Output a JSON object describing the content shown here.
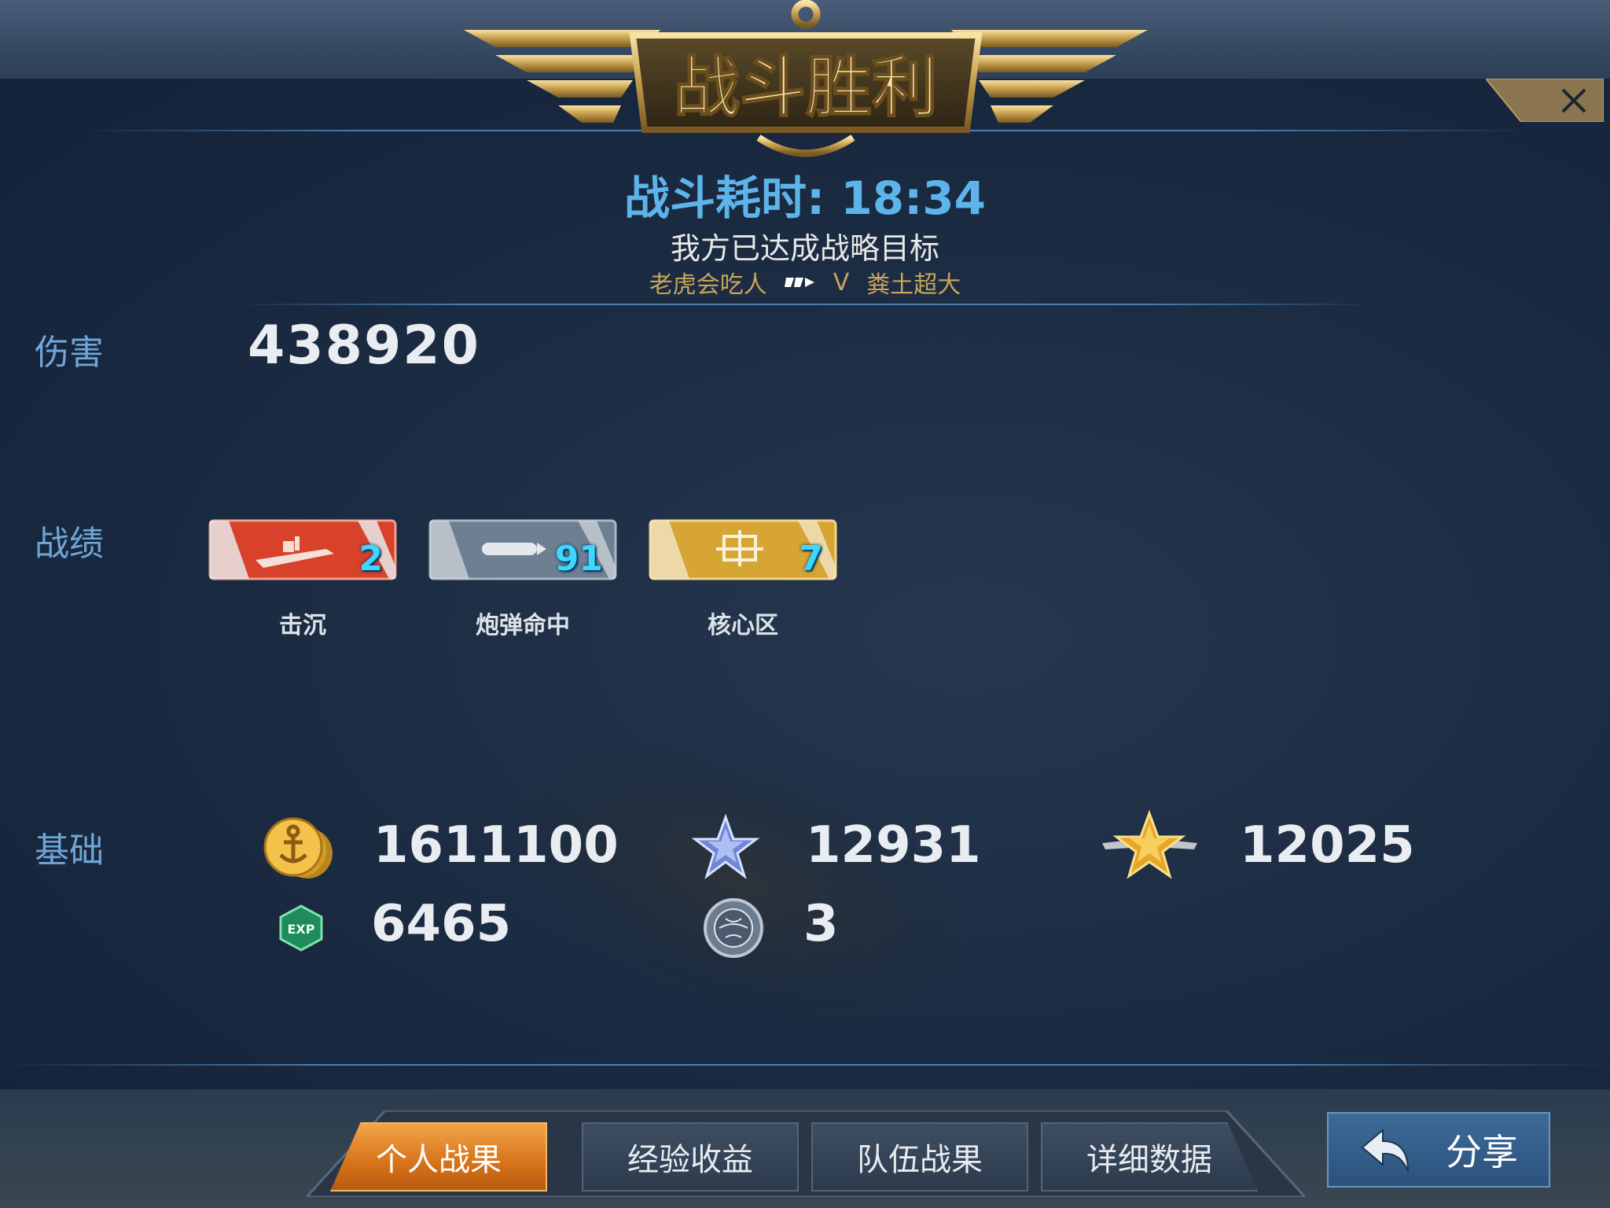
{
  "header": {
    "banner_title": "战斗胜利",
    "time_label": "战斗耗时: 18:34",
    "objective": "我方已达成战略目标",
    "player_left": "老虎会吃人",
    "vs": "V",
    "player_right": "粪土超大"
  },
  "rows": {
    "damage_label": "伤害",
    "damage_value": "438920",
    "record_label": "战绩",
    "base_label": "基础"
  },
  "medals": [
    {
      "caption": "击沉",
      "count": "2",
      "color": "#d8412a"
    },
    {
      "caption": "炮弹命中",
      "count": "91",
      "color": "#6e7f92"
    },
    {
      "caption": "核心区",
      "count": "7",
      "color": "#d7a534"
    }
  ],
  "base_stats": {
    "silver": "1611100",
    "exp": "6465",
    "blue_star": "12931",
    "globe": "3",
    "gold_star": "12025",
    "exp_icon_text": "EXP"
  },
  "tabs": [
    {
      "label": "个人战果",
      "active": true
    },
    {
      "label": "经验收益",
      "active": false
    },
    {
      "label": "队伍战果",
      "active": false
    },
    {
      "label": "详细数据",
      "active": false
    }
  ],
  "share_label": "分享",
  "icons": {
    "close": "close-icon",
    "share": "back-arrow-icon",
    "anchor": "anchor-icon"
  },
  "colors": {
    "accent_blue": "#5db4ea",
    "label_blue": "#6fa6d6",
    "gold": "#c8a35a",
    "active_tab": "#d6731a"
  }
}
